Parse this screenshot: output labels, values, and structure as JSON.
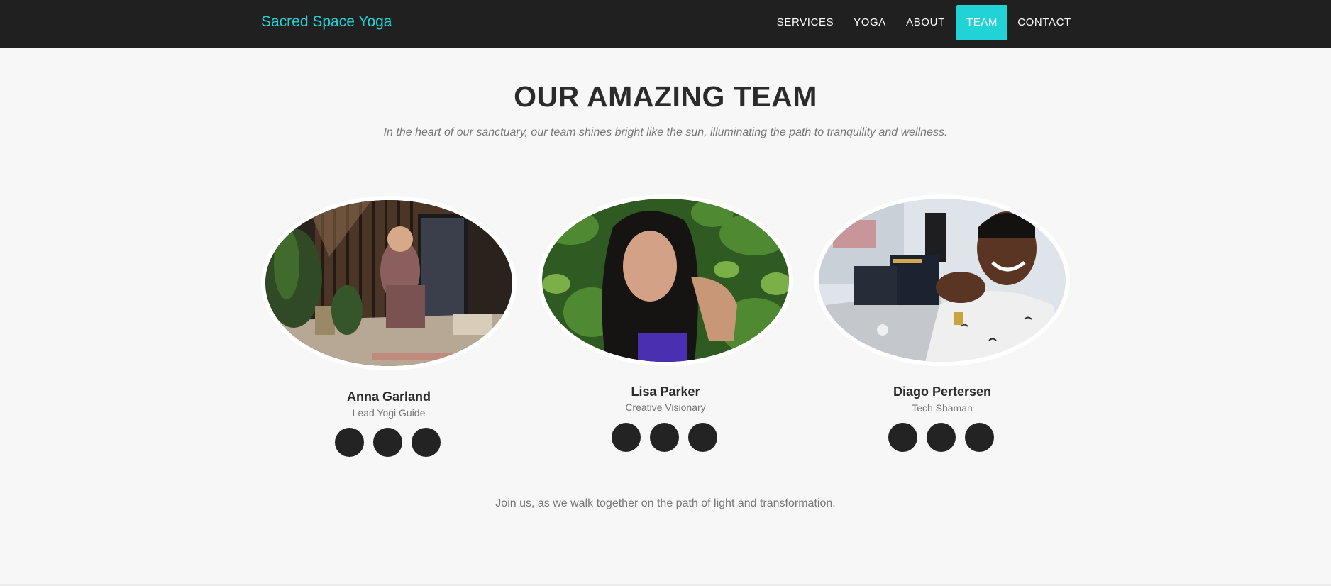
{
  "navbar": {
    "brand": "Sacred Space Yoga",
    "items": [
      {
        "label": "SERVICES",
        "active": false
      },
      {
        "label": "YOGA",
        "active": false
      },
      {
        "label": "ABOUT",
        "active": false
      },
      {
        "label": "TEAM",
        "active": true
      },
      {
        "label": "CONTACT",
        "active": false
      }
    ]
  },
  "header": {
    "title": "OUR AMAZING TEAM",
    "subtitle": "In the heart of our sanctuary, our team shines bright like the sun, illuminating the path to tranquility and wellness."
  },
  "team": [
    {
      "name": "Anna Garland",
      "role": "Lead Yogi Guide"
    },
    {
      "name": "Lisa Parker",
      "role": "Creative Visionary"
    },
    {
      "name": "Diago Pertersen",
      "role": "Tech Shaman"
    }
  ],
  "footer": {
    "text": "Join us, as we walk together on the path of light and transformation."
  },
  "colors": {
    "accent": "#22d3d6",
    "navbar_bg": "#202020",
    "page_bg": "#f7f7f7",
    "social_bg": "#232323"
  }
}
